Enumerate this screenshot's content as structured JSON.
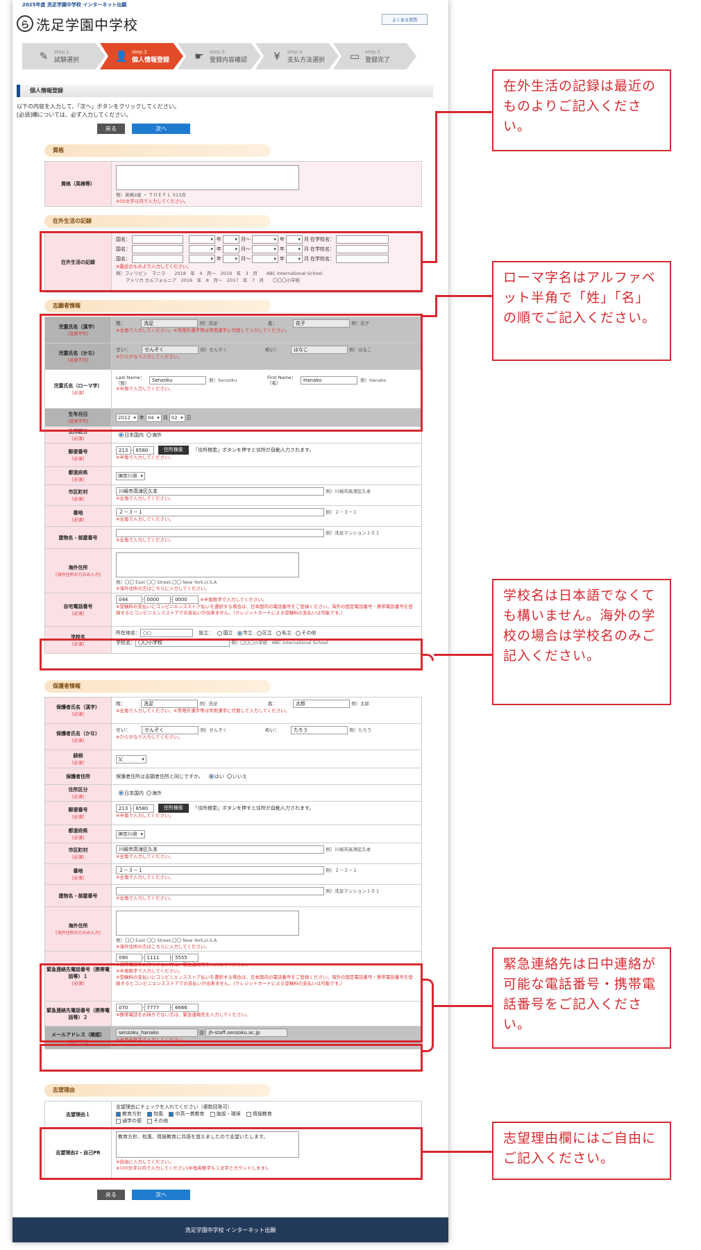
{
  "header": {
    "top_note": "2025年度 洗足学園中学校 インターネット出願",
    "logo_mark": "ら",
    "school_name": "洗足学園中学校",
    "faq_label": "よくある質問"
  },
  "steps": [
    {
      "num": "step.1",
      "label": "試験選択",
      "icon": "edit-icon"
    },
    {
      "num": "step.2",
      "label": "個人情報登録",
      "icon": "person-icon"
    },
    {
      "num": "step.3",
      "label": "登録内容確認",
      "icon": "hand-icon"
    },
    {
      "num": "step.4",
      "label": "支払方法選択",
      "icon": "yen-icon"
    },
    {
      "num": "step.5",
      "label": "登録完了",
      "icon": "monitor-icon"
    }
  ],
  "page_title": "個人情報登録",
  "intro": [
    "以下の内容を入力して、「次へ」ボタンをクリックしてください。",
    "[必須]欄については、必ず入力してください。"
  ],
  "buttons": {
    "back": "戻る",
    "next": "次へ"
  },
  "sections": {
    "qual": "資格",
    "abroad": "在外生活の記録",
    "applicant": "志願者情報",
    "guardian": "保護者情報",
    "reason": "志望理由"
  },
  "qual": {
    "label": "資格（英検等）",
    "example": "例）英検2級 ・ ＴＯＥＦＬ 513点",
    "note": "※50文字以内で入力してください。"
  },
  "abroad": {
    "label": "在外生活の記録",
    "rows_label": "国名：",
    "year": "年",
    "month": "月～",
    "month2": "月",
    "school": "在学校名：",
    "note": "※最近のものより入力してください。",
    "ex1": "例）フィリピン　マニラ　　2018　年　4　月～　2019　年　3　月　　ABC International School",
    "ex2": "アメリカ カルフォルニア　2016　年　8　月～　2017　年　7　月　　〇〇〇小学校"
  },
  "applicant": {
    "kanji": {
      "label": "児童氏名（漢字）",
      "req": "[変更不可]",
      "sei_l": "姓：",
      "sei": "洗足",
      "sei_ex": "例）洗足",
      "mei_l": "名：",
      "mei": "花子",
      "mei_ex": "例）花子",
      "note": "※全角で入力してください。※常用外漢字等は常用漢字に代替して入力してください。"
    },
    "kana": {
      "label": "児童氏名（かな）",
      "req": "[変更不可]",
      "sei_l": "せい：",
      "sei": "せんぞく",
      "sei_ex": "例）せんぞく",
      "mei_l": "めい：",
      "mei": "はなこ",
      "mei_ex": "例）はなこ",
      "note": "※ひらがなで入力してください。"
    },
    "roma": {
      "label": "児童氏名（ローマ字）",
      "req": "[必須]",
      "last_l": "Last Name：（姓）",
      "last": "Senzoku",
      "last_ex": "例）Senzoku",
      "first_l": "First Name：（名）",
      "first": "Hanako",
      "first_ex": "例）Hanako",
      "note": "※半角で入力してください。"
    },
    "birth": {
      "label": "生年月日",
      "req": "[変更不可]",
      "y": "2012",
      "m": "04",
      "d": "02",
      "yl": "年",
      "ml": "月",
      "dl": "日"
    },
    "area": {
      "label": "住所区分",
      "req": "[必須]",
      "opt1": "日本国内",
      "opt2": "海外"
    },
    "zip": {
      "label": "郵便番号",
      "req": "[必須]",
      "a": "213",
      "b": "8580",
      "btn": "住所検索",
      "hint": "「住所検索」ボタンを押すと住所が自動入力されます。",
      "note": "※半角で入力してください。"
    },
    "pref": {
      "label": "都道府県",
      "req": "[必須]",
      "val": "神奈川県"
    },
    "city": {
      "label": "市区町村",
      "req": "[必須]",
      "val": "川崎市高津区久本",
      "ex": "例）川崎市高津区久本",
      "note": "※全角で入力してください。"
    },
    "addr": {
      "label": "番地",
      "req": "[必須]",
      "val": "２－３－１",
      "ex": "例）２－３－１",
      "note": "※全角で入力してください。"
    },
    "bldg": {
      "label": "建物名・部屋番号",
      "ex": "例）洗足マンション１０１",
      "note": "※全角で入力してください。"
    },
    "overseas": {
      "label": "海外住所",
      "req": "[海外住所の方のみ入力]",
      "ex": "例）〇〇 East 〇〇 Street,〇〇 New York,U.S.A",
      "note": "※海外住所の方はこちらに入力してください。"
    },
    "tel": {
      "label": "自宅電話番号",
      "req": "[必須]",
      "a": "044",
      "b": "0000",
      "c": "0000",
      "n1": "※半角数字で入力してください。",
      "n2": "※受験料の支払いにコンビニエンスストア払いを選択する場合は、日本国内の電話番号をご登録ください。海外の固定電話番号・携帯電話番号を登録するとコンビニエンスストアでの支払いが出来ません。（クレジットカードによる受験料の支払いは可能です。）"
    },
    "school": {
      "label": "学校名",
      "req": "[必須]",
      "loc_l": "所在地名：",
      "loc": "○○",
      "est_l": "設立：",
      "o1": "国立",
      "o2": "市立",
      "o3": "区立",
      "o4": "私立",
      "o5": "その他",
      "name_l": "学校名：",
      "name": "〇〇小学校",
      "ex": "例）〇〇〇小学校　ABC International School"
    }
  },
  "guardian": {
    "kanji": {
      "label": "保護者氏名（漢字）",
      "req": "[必須]",
      "sei_l": "姓：",
      "sei": "洗足",
      "sei_ex": "例）洗足",
      "mei_l": "名：",
      "mei": "太郎",
      "mei_ex": "例）太郎",
      "note": "※全角で入力してください。※常用外漢字等は常用漢字に代替して入力してください。"
    },
    "kana": {
      "label": "保護者氏名（かな）",
      "req": "[必須]",
      "sei_l": "せい：",
      "sei": "せんぞく",
      "sei_ex": "例）せんぞく",
      "mei_l": "めい：",
      "mei": "たろう",
      "mei_ex": "例）たろう",
      "note": "※ひらがなで入力してください。"
    },
    "rel": {
      "label": "続柄",
      "req": "[必須]",
      "val": "父"
    },
    "addr_same": {
      "label": "保護者住所",
      "q": "保護者住所は志願者住所と同じですか。",
      "yes": "はい",
      "no": "いいえ"
    },
    "area": {
      "label": "住所区分",
      "req": "[必須]",
      "opt1": "日本国内",
      "opt2": "海外"
    },
    "zip": {
      "label": "郵便番号",
      "req": "[必須]",
      "a": "213",
      "b": "8580",
      "btn": "住所検索",
      "hint": "「住所検索」ボタンを押すと住所が自動入力されます。",
      "note": "※半角で入力してください。"
    },
    "pref": {
      "label": "都道府県",
      "req": "[必須]",
      "val": "神奈川県"
    },
    "city": {
      "label": "市区町村",
      "req": "[必須]",
      "val": "川崎市高津区久本",
      "ex": "例）川崎市高津区久本",
      "note": "※全角で入力してください。"
    },
    "addr": {
      "label": "番地",
      "req": "[必須]",
      "val": "２－３－１",
      "ex": "例）２－３－１",
      "note": "※全角で入力してください。"
    },
    "bldg": {
      "label": "建物名・部屋番号",
      "ex": "例）洗足マンション１０１",
      "note": "※全角で入力してください。"
    },
    "overseas": {
      "label": "海外住所",
      "req": "[海外住所の方のみ入力]",
      "ex": "例）〇〇 East 〇〇 Street,〇〇 New York,U.S.A",
      "note": "※海外住所の方はこちらに入力してください。"
    },
    "em1": {
      "label": "緊急連絡先電話番号（携帯電話等）１",
      "req": "[必須]",
      "a": "090",
      "b": "1111",
      "c": "5555",
      "n1": "※携帯電話をお持ちでない方は、緊急連絡先を入力してください。",
      "n2": "※半角数字で入力してください。",
      "n3": "※受験料の支払いにコンビニエンスストア払いを選択する場合は、日本国内の電話番号をご登録ください。海外の固定電話番号・携帯電話番号を登録するとコンビニエンスストアでの支払いが出来ません。（クレジットカードによる受験料の支払いは可能です。）"
    },
    "em2": {
      "label": "緊急連絡先電話番号（携帯電話等）２",
      "a": "070",
      "b": "7777",
      "c": "6666",
      "n1": "※携帯電話をお持ちでない方は、緊急連絡先を入力してください。"
    },
    "mail": {
      "label": "メールアドレス（確認）",
      "req": "[変更不可]",
      "user": "senzoku_hanako",
      "domain": "jh-staff.senzoku.ac.jp",
      "at": "@",
      "note": "※半角英数字で入力してください。"
    }
  },
  "reason": {
    "r1": {
      "label": "志望理由１",
      "q": "志望理由にチェックを入れてください（複数回答可）",
      "c1": "教育方針",
      "c2": "校風",
      "c3": "中高一貫教育",
      "c4": "施設・環境",
      "c5": "情操教育",
      "c6": "通学の便",
      "c7": "その他"
    },
    "r2": {
      "label": "志望理由2・自己PR",
      "val": "教育方針、校風、情操教育に共感を覚えましたので志望いたします。",
      "n1": "※自由に入力してください。",
      "n2": "※100文字以内で入力してください(半角英数字も１文字とカウントします)。"
    }
  },
  "footer": "洗足学園中学校 インターネット出願",
  "callouts": {
    "c1": "在外生活の記録は最近のものよりご記入ください。",
    "c2": "ローマ字名はアルファベット半角で「姓」「名」の順でご記入ください。",
    "c3": "学校名は日本語でなくても構いません。海外の学校の場合は学校名のみご記入ください。",
    "c4": "緊急連絡先は日中連絡が可能な電話番号・携帯電話番号をご記入ください。",
    "c5": "志望理由欄にはご自由にご記入ください。"
  }
}
